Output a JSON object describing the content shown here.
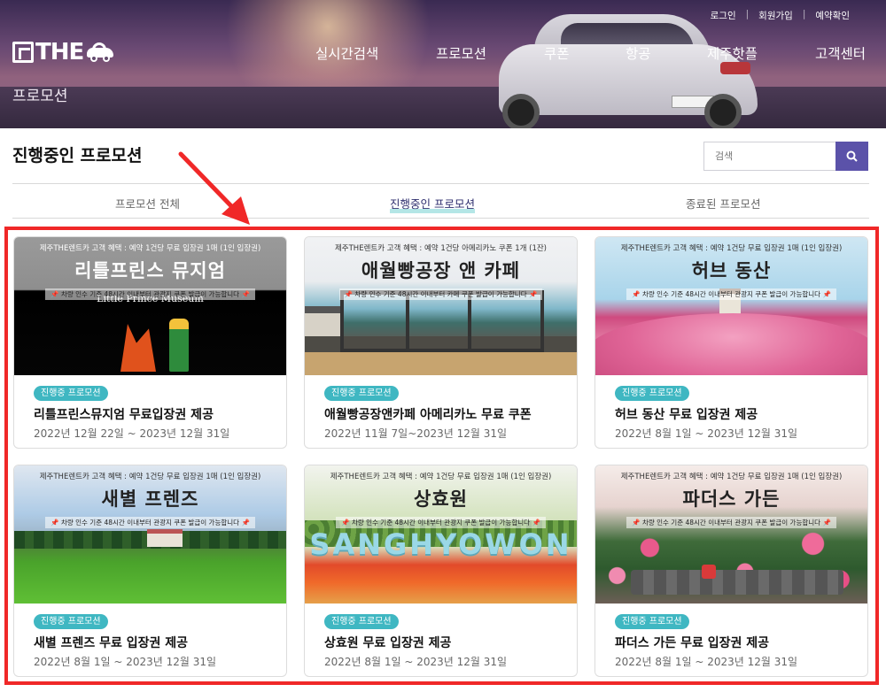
{
  "header": {
    "top_links": [
      "로그인",
      "회원가입",
      "예약확인"
    ],
    "logo": {
      "text": "THE"
    },
    "nav": [
      "실시간검색",
      "프로모션",
      "쿠폰",
      "항공",
      "제주핫플",
      "고객센터"
    ],
    "breadcrumb": "프로모션"
  },
  "page": {
    "title": "진행중인 프로모션",
    "search": {
      "placeholder": "검색",
      "value": ""
    }
  },
  "tabs": [
    {
      "label": "프로모션 전체",
      "active": false
    },
    {
      "label": "진행중인 프로모션",
      "active": true
    },
    {
      "label": "종료된 프로모션",
      "active": false
    }
  ],
  "colors": {
    "accent": "#5b52a9",
    "badge": "#3fb7c2",
    "annotation": "#f02828"
  },
  "cards": [
    {
      "banner_benefit": "제주THE렌트카 고객 혜택 : 예약 1건당 무료 입장권 1매 (1인 입장권)",
      "banner_title": "리틀프린스 뮤지엄",
      "banner_notice": "📌 차량 인수 기준 48시간 이내부터 관광지 쿠폰 발급이 가능합니다 📌",
      "image_caption": "Little Prince Museum",
      "status": "진행중 프로모션",
      "name": "리틀프린스뮤지엄 무료입장권 제공",
      "date": "2022년 12월 22일 ~ 2023년 12월 31일"
    },
    {
      "banner_benefit": "제주THE렌트카 고객 혜택 : 예약 1건당 아메리카노 쿠폰 1개 (1잔)",
      "banner_title": "애월빵공장 앤 카페",
      "banner_notice": "📌 차량 인수 기준 48시간 이내부터 카페 쿠폰 발급이 가능합니다 📌",
      "status": "진행중 프로모션",
      "name": "애월빵공장앤카페 아메리카노 무료 쿠폰",
      "date": "2022년 11월 7일~2023년 12월 31일"
    },
    {
      "banner_benefit": "제주THE렌트카 고객 혜택 : 예약 1건당 무료 입장권 1매 (1인 입장권)",
      "banner_title": "허브 동산",
      "banner_notice": "📌 차량 인수 기준 48시간 이내부터 관광지 쿠폰 발급이 가능합니다 📌",
      "status": "진행중 프로모션",
      "name": "허브 동산 무료 입장권 제공",
      "date": "2022년 8월 1일 ~ 2023년 12월 31일"
    },
    {
      "banner_benefit": "제주THE렌트카 고객 혜택 : 예약 1건당 무료 입장권 1매 (1인 입장권)",
      "banner_title": "새별 프렌즈",
      "banner_notice": "📌 차량 인수 기준 48시간 이내부터 관광지 쿠폰 발급이 가능합니다 📌",
      "status": "진행중 프로모션",
      "name": "새별 프렌즈 무료 입장권 제공",
      "date": "2022년 8월 1일 ~ 2023년 12월 31일"
    },
    {
      "banner_benefit": "제주THE렌트카 고객 혜택 : 예약 1건당 무료 입장권 1매 (1인 입장권)",
      "banner_title": "상효원",
      "banner_notice": "📌 차량 인수 기준 48시간 이내부터 관광지 쿠폰 발급이 가능합니다 📌",
      "image_sign": "SANGHYOWON",
      "status": "진행중 프로모션",
      "name": "상효원 무료 입장권 제공",
      "date": "2022년 8월 1일 ~ 2023년 12월 31일"
    },
    {
      "banner_benefit": "제주THE렌트카 고객 혜택 : 예약 1건당 무료 입장권 1매 (1인 입장권)",
      "banner_title": "파더스 가든",
      "banner_notice": "📌 차량 인수 기준 48시간 이내부터 관광지 쿠폰 발급이 가능합니다 📌",
      "status": "진행중 프로모션",
      "name": "파더스 가든 무료 입장권 제공",
      "date": "2022년 8월 1일 ~ 2023년 12월 31일"
    }
  ]
}
